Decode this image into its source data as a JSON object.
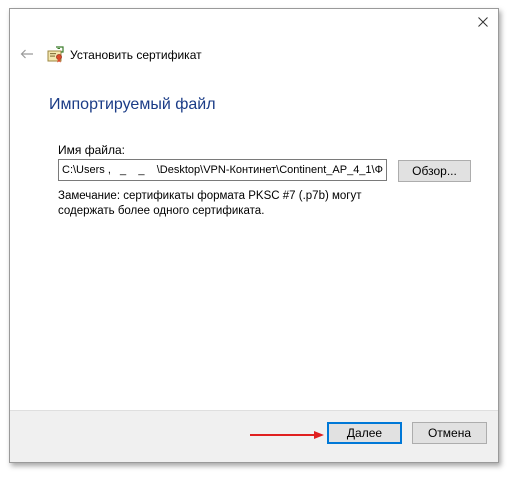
{
  "window": {
    "title": "Установить сертификат",
    "icons": {
      "close": "close-icon",
      "back": "back-arrow-icon",
      "certificate": "certificate-icon"
    }
  },
  "page": {
    "heading": "Импортируемый файл",
    "file_label": "Имя файла:",
    "file_value": "C:\\Users ,   _    _    \\Desktop\\VPN-Континет\\Continent_AP_4_1\\Ф",
    "browse_label": "Обзор...",
    "note": "Замечание:  сертификаты формата PKSC #7 (.p7b) могут содержать более одного сертификата."
  },
  "footer": {
    "next_label": "Далее",
    "cancel_label": "Отмена"
  },
  "colors": {
    "heading": "#1b3c87",
    "accent": "#0078d7",
    "annotation_arrow": "#e02020",
    "footer_bg": "#f0f0f0"
  }
}
